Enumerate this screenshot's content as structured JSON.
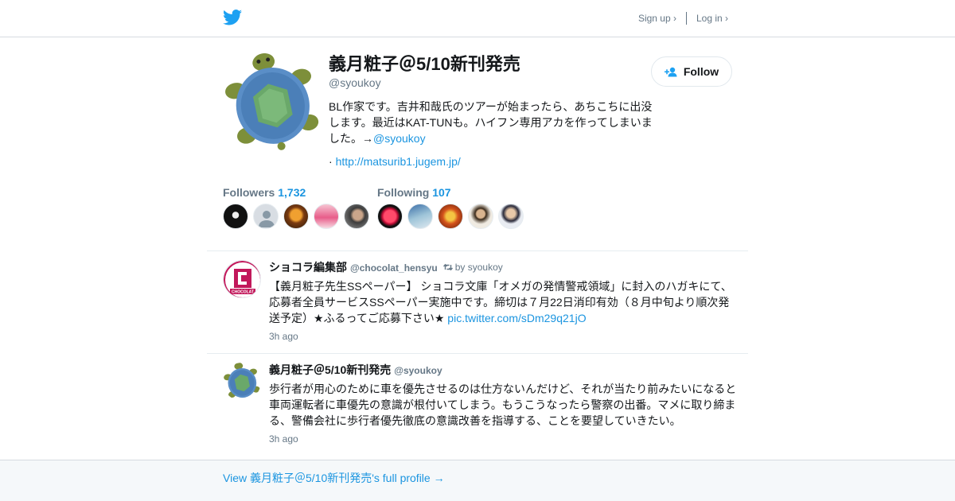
{
  "nav": {
    "signup": "Sign up ›",
    "login": "Log in ›"
  },
  "profile": {
    "name": "義月粧子＠5/10新刊発売",
    "handle": "@syoukoy",
    "bio_text": "BL作家です。吉井和哉氏のツアーが始まったら、あちこちに出没します。最近はKAT-TUNも。ハイフン専用アカを作ってしまいました。→",
    "bio_link": "@syoukoy",
    "url_prefix": "· ",
    "url": "http://matsurib1.jugem.jp/",
    "follow_label": "Follow"
  },
  "stats": {
    "followers_label": "Followers",
    "followers_count": "1,732",
    "following_label": "Following",
    "following_count": "107"
  },
  "tweets": [
    {
      "name": "ショコラ編集部",
      "handle": "@chocolat_hensyu",
      "retweet_by": "by syoukoy",
      "text": "【義月粧子先生SSペーパー】 ショコラ文庫「オメガの発情警戒領域」に封入のハガキにて、応募者全員サービスSSペーパー実施中です。締切は７月22日消印有効（８月中旬より順次発送予定）★ふるってご応募下さい★ ",
      "link": "pic.twitter.com/sDm29q21jO",
      "time": "3h ago",
      "avatar_label": "CHOCOLAT"
    },
    {
      "name": "義月粧子＠5/10新刊発売",
      "handle": "@syoukoy",
      "text": "歩行者が用心のために車を優先させるのは仕方ないんだけど、それが当たり前みたいになると車両運転者に車優先の意識が根付いてしまう。もうこうなったら警察の出番。マメに取り締まる、警備会社に歩行者優先徹底の意識改善を指導する、ことを要望していきたい。",
      "time": "3h ago"
    }
  ],
  "footer": {
    "link": "View 義月粧子＠5/10新刊発売's full profile →"
  },
  "colors": {
    "link": "#1b95e0",
    "muted": "#657786",
    "twitter_blue": "#1da1f2"
  }
}
